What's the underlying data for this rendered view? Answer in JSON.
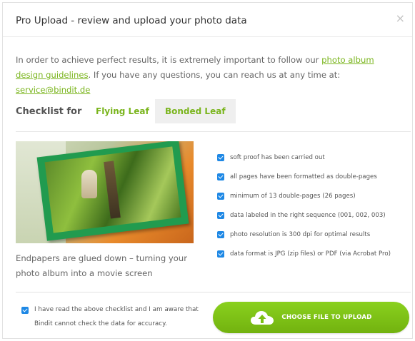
{
  "modal": {
    "title": "Pro Upload - review and upload your photo data",
    "close_icon": "×"
  },
  "intro": {
    "text_1": "In order to achieve perfect results, it is extremely important to follow our ",
    "link_guidelines": "photo album design guidelines",
    "text_2": ". If you have any questions, you can reach us at any time at: ",
    "link_email": "service@bindit.de"
  },
  "checklist": {
    "label": "Checklist for",
    "tabs": [
      {
        "label": "Flying Leaf",
        "active": false
      },
      {
        "label": "Bonded Leaf",
        "active": true
      }
    ],
    "items": [
      "soft proof has been carried out",
      "all pages have been formatted as double-pages",
      "minimum of 13 double-pages (26 pages)",
      "data labeled in the right sequence (001, 002, 003)",
      "photo resolution is 300 dpi for optimal results",
      "data format is JPG (zip files) or PDF (via Acrobat Pro)"
    ]
  },
  "caption": "Endpapers are glued down – turning your photo album into a movie screen",
  "confirm": {
    "text": "I have read the above checklist and I am aware that Bindit cannot check the data for accuracy.",
    "checked": true
  },
  "upload_button": {
    "label": "CHOOSE FILE TO UPLOAD",
    "icon": "cloud-upload-icon"
  },
  "colors": {
    "accent_green": "#7ab51d",
    "checkbox_blue": "#1e88e5",
    "button_green": "#7cc014"
  }
}
